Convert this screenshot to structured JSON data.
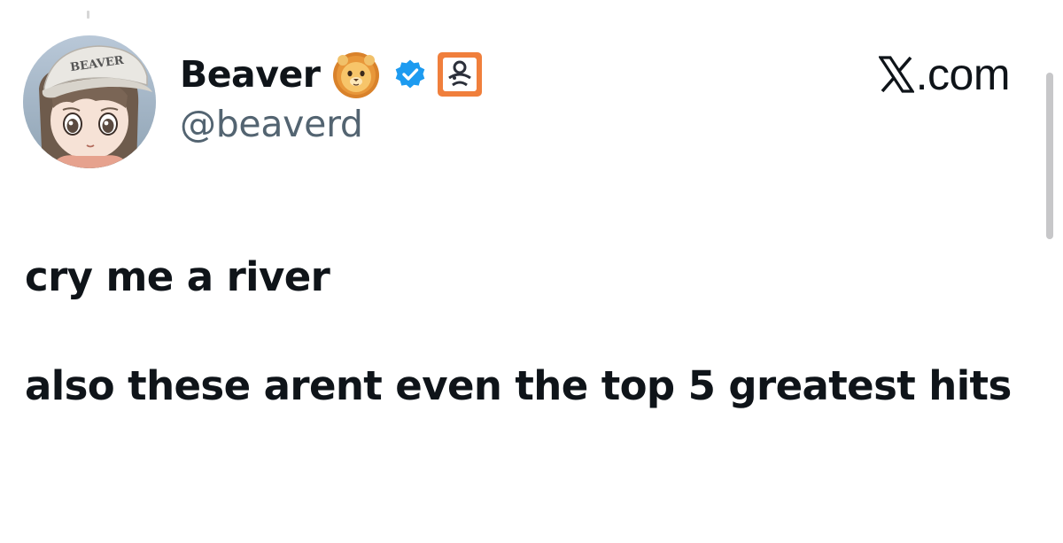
{
  "author": {
    "display_name": "Beaver",
    "handle": "@beaverd",
    "avatar": "anime-girl-avatar",
    "cap_text": "BEAVER",
    "badges": [
      "lion-emoji",
      "verified-badge",
      "affiliate-badge"
    ],
    "verified_color": "#1d9bf0",
    "affiliate_color": "#f07f3c"
  },
  "brand": {
    "logo": "x-logo",
    "domain": ".com"
  },
  "tweet": {
    "line_1": "cry me a river",
    "line_2": "also these arent even the top 5 greatest hits"
  }
}
